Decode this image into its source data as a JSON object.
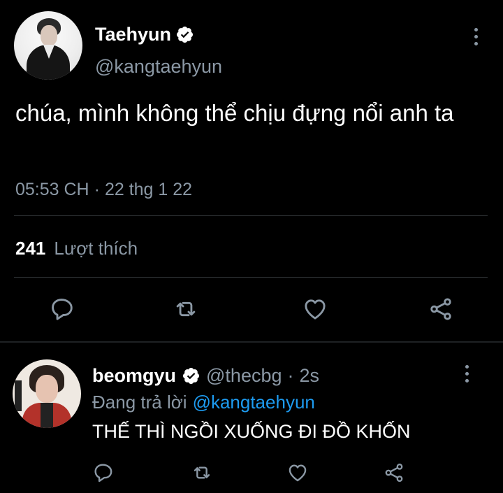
{
  "tweet": {
    "author": {
      "name": "Taehyun",
      "handle": "@kangtaehyun"
    },
    "text": "chúa, mình không thể chịu đựng nổi anh ta",
    "time": "05:53 CH",
    "date": "22 thg 1 22",
    "separator": "·",
    "likes": {
      "count": "241",
      "label": "Lượt thích"
    },
    "actions": [
      "reply-icon",
      "retweet-icon",
      "like-icon",
      "share-icon"
    ]
  },
  "reply": {
    "author": {
      "name": "beomgyu",
      "handle": "@thecbg",
      "time": "2s",
      "separator": "·"
    },
    "replying_label": "Đang trả lời",
    "replying_to": "@kangtaehyun",
    "text": "THẾ THÌ NGỒI XUỐNG ĐI ĐỒ KHỐN",
    "actions": [
      "reply-icon",
      "retweet-icon",
      "like-icon",
      "share-icon"
    ]
  },
  "colors": {
    "background": "#000000",
    "text": "#ffffff",
    "secondary": "#8b98a5",
    "verified": "#ffffff",
    "link": "#1d9bf0",
    "divider": "#2f3336"
  }
}
